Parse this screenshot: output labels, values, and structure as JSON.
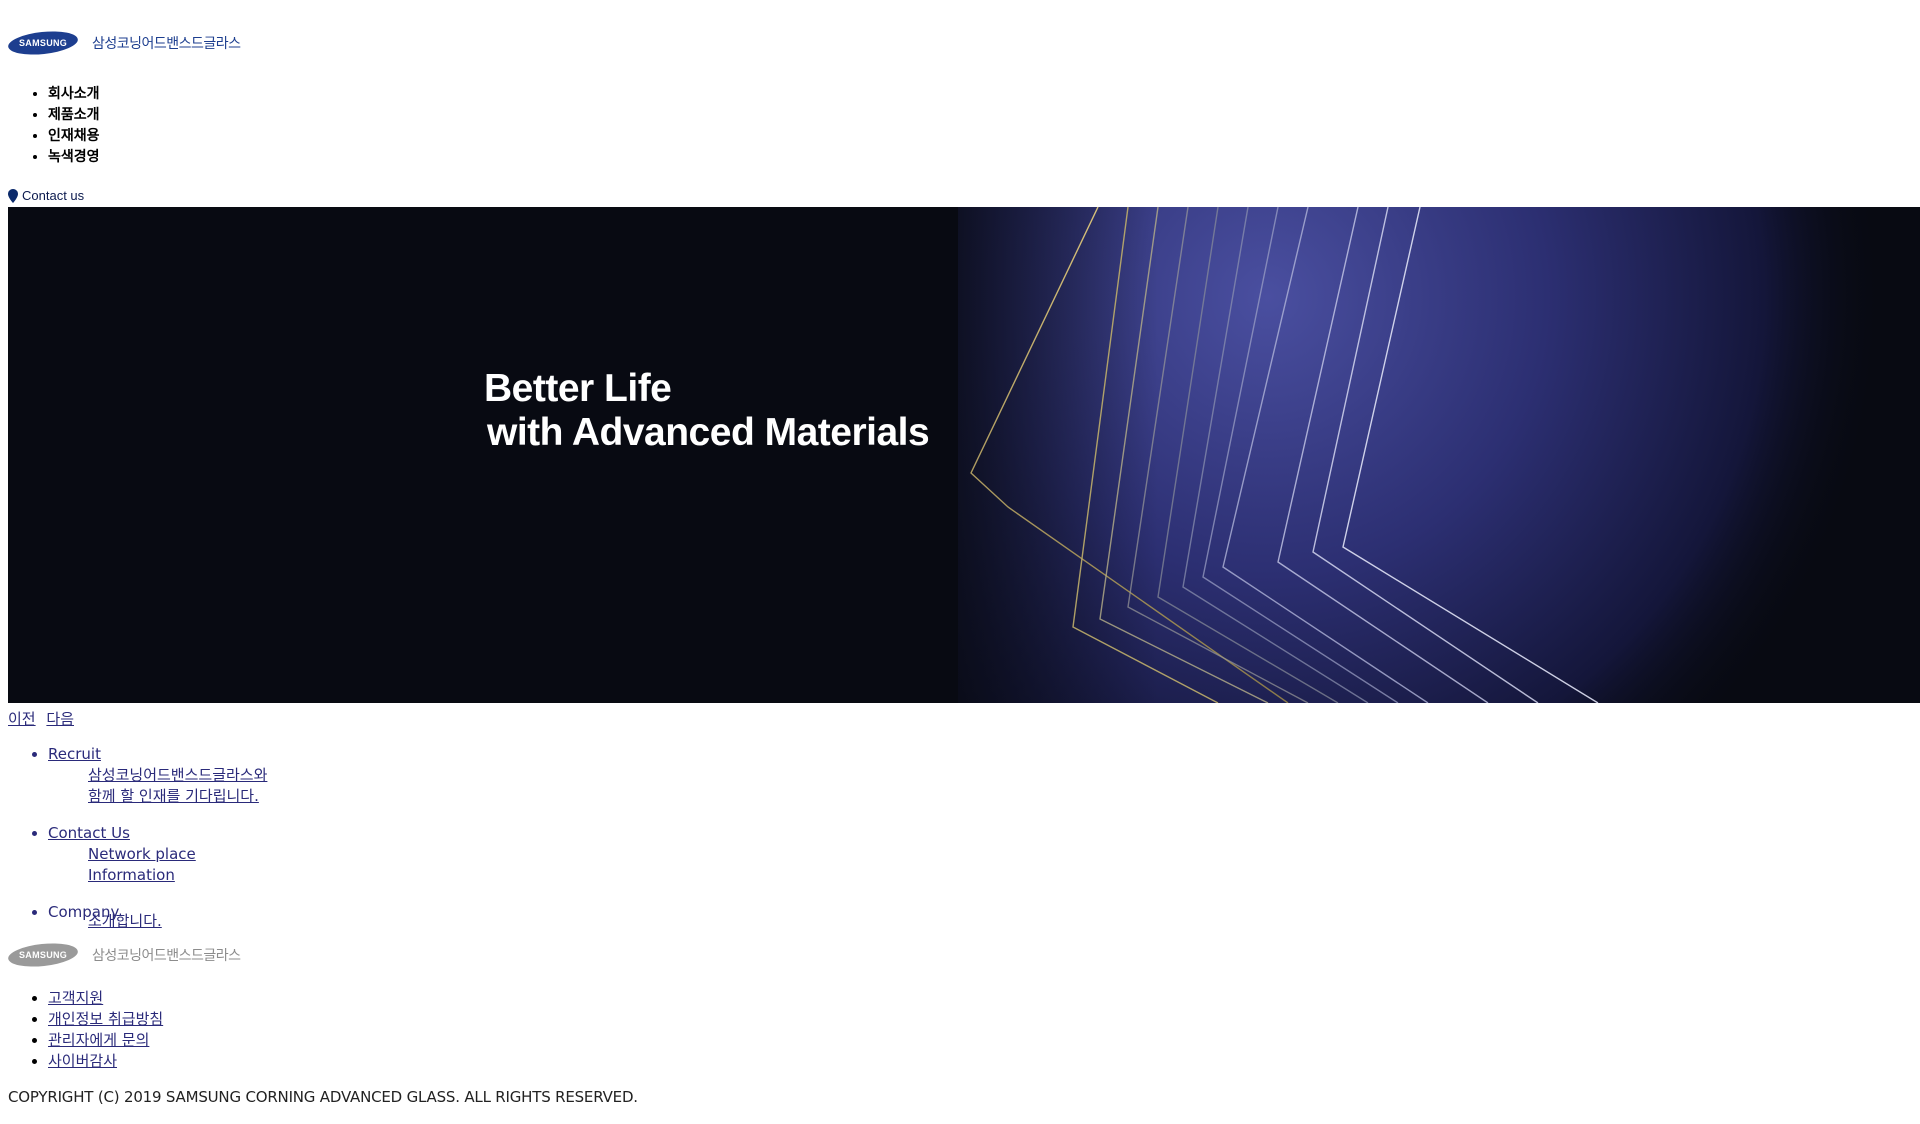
{
  "header": {
    "brand_mark": "SAMSUNG",
    "company_name": "삼성코닝어드밴스드글라스"
  },
  "nav": {
    "items": [
      {
        "label": "회사소개"
      },
      {
        "label": "제품소개"
      },
      {
        "label": "인재채용"
      },
      {
        "label": "녹색경영"
      }
    ]
  },
  "contact": {
    "label": "Contact us",
    "icon": "location-pin-icon"
  },
  "hero": {
    "line1": "Better Life",
    "line2": "with Advanced Materials",
    "colors": {
      "background": "#080a12",
      "accent": "#3a3f8f",
      "gold": "#c9b46a"
    }
  },
  "slider": {
    "prev_label": "이전",
    "next_label": "다음"
  },
  "quick_links": [
    {
      "title": "Recruit",
      "desc_line1": "삼성코닝어드밴스드글라스와",
      "desc_line2": "함께 할 인재를 기다립니다."
    },
    {
      "title": "Contact Us",
      "desc_line1": "Network place",
      "desc_line2": "Information"
    },
    {
      "title": "Company",
      "desc_line1": "소개합니다.",
      "desc_line2": ""
    }
  ],
  "footer": {
    "brand_mark": "SAMSUNG",
    "company_name": "삼성코닝어드밴스드글라스",
    "links": [
      {
        "label": "고객지원"
      },
      {
        "label": "개인정보 취급방침"
      },
      {
        "label": "관리자에게 문의"
      },
      {
        "label": "사이버감사"
      }
    ],
    "copyright": "COPYRIGHT (C) 2019 SAMSUNG CORNING ADVANCED GLASS. ALL RIGHTS RESERVED."
  },
  "colors": {
    "brand_blue": "#1d3e8f",
    "link": "#2a2a7a"
  }
}
